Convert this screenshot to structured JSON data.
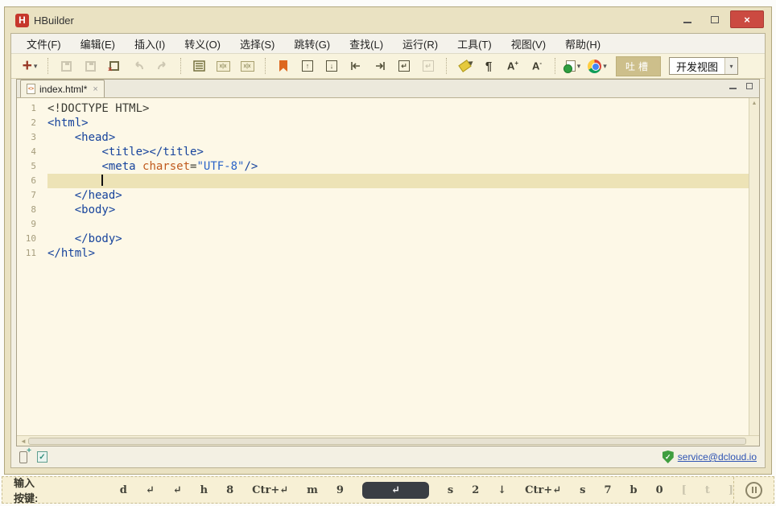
{
  "window": {
    "title": "HBuilder",
    "controls": {
      "minimize": "minimize",
      "maximize": "maximize",
      "close": "×"
    }
  },
  "menu": {
    "items": [
      "文件(F)",
      "编辑(E)",
      "插入(I)",
      "转义(O)",
      "选择(S)",
      "跳转(G)",
      "查找(L)",
      "运行(R)",
      "工具(T)",
      "视图(V)",
      "帮助(H)"
    ]
  },
  "toolbar": {
    "icons": [
      "new-file",
      "save",
      "save-all",
      "close-all",
      "undo",
      "redo",
      "format-code",
      "xml-validate",
      "xml-schema",
      "bookmark",
      "import-line",
      "extract-line",
      "jump-line-start",
      "jump-line-end",
      "soft-wrap",
      "soft-wrap-disabled",
      "highlighter",
      "pilcrow",
      "font-increase",
      "font-decrease",
      "run-in-browser",
      "chrome-browser"
    ],
    "glyphs": {
      "plus": "+",
      "caret": "▾",
      "pilcrow": "¶",
      "font_increase": "A",
      "font_increase_sup": "+",
      "font_decrease": "A",
      "font_decrease_sup": "-",
      "xml": "x|x"
    },
    "feedback_label": "吐槽",
    "view_select_value": "开发视图"
  },
  "tabbar": {
    "tabs": [
      {
        "label": "index.html*",
        "close": "×",
        "icon": "html-file"
      }
    ]
  },
  "editor": {
    "lines": [
      {
        "n": 1,
        "indent": 0,
        "segments": [
          {
            "t": "<!DOCTYPE HTML>",
            "c": "doctype"
          }
        ]
      },
      {
        "n": 2,
        "indent": 0,
        "segments": [
          {
            "t": "<html>",
            "c": "tag"
          }
        ]
      },
      {
        "n": 3,
        "indent": 1,
        "segments": [
          {
            "t": "<head>",
            "c": "tag"
          }
        ]
      },
      {
        "n": 4,
        "indent": 2,
        "segments": [
          {
            "t": "<title></title>",
            "c": "tag"
          }
        ]
      },
      {
        "n": 5,
        "indent": 2,
        "segments": [
          {
            "t": "<meta ",
            "c": "tag"
          },
          {
            "t": "charset",
            "c": "attr"
          },
          {
            "t": "=",
            "c": "plain"
          },
          {
            "t": "\"UTF-8\"",
            "c": "str"
          },
          {
            "t": "/>",
            "c": "tag"
          }
        ]
      },
      {
        "n": 6,
        "indent": 2,
        "segments": [],
        "current": true,
        "cursor": true
      },
      {
        "n": 7,
        "indent": 1,
        "segments": [
          {
            "t": "</head>",
            "c": "tag"
          }
        ]
      },
      {
        "n": 8,
        "indent": 1,
        "segments": [
          {
            "t": "<body>",
            "c": "tag"
          }
        ]
      },
      {
        "n": 9,
        "indent": 0,
        "segments": []
      },
      {
        "n": 10,
        "indent": 1,
        "segments": [
          {
            "t": "</body>",
            "c": "tag"
          }
        ]
      },
      {
        "n": 11,
        "indent": 0,
        "segments": [
          {
            "t": "</html>",
            "c": "tag"
          }
        ]
      }
    ]
  },
  "statusbar": {
    "icons": [
      "device-plus",
      "clipboard-check",
      "shield-check"
    ],
    "link_label": "service@dcloud.io"
  },
  "keybar": {
    "label": "输入按键:",
    "keys": [
      {
        "t": "d"
      },
      {
        "t": "↵"
      },
      {
        "t": "↵"
      },
      {
        "t": "h"
      },
      {
        "t": "8"
      },
      {
        "t": "Ctr+↵"
      },
      {
        "t": "m"
      },
      {
        "t": "9"
      },
      {
        "t": "↵",
        "style": "dark"
      },
      {
        "t": "s"
      },
      {
        "t": "2"
      },
      {
        "t": "↓"
      },
      {
        "t": "Ctr+↵"
      },
      {
        "t": "s"
      },
      {
        "t": "7"
      },
      {
        "t": "b"
      },
      {
        "t": "0"
      },
      {
        "t": "[",
        "style": "faded"
      },
      {
        "t": "t",
        "style": "faded"
      },
      {
        "t": "]",
        "style": "faded"
      }
    ]
  },
  "colors": {
    "frame": "#EAE2C2",
    "toolbar_bg": "#F8F3DD",
    "editor_bg": "#FDF8E7",
    "current_line": "#EDE3B6",
    "tag": "#16439c",
    "attr": "#c05a1d",
    "string": "#2a63c8",
    "close_button": "#cb4a41",
    "bookmark": "#DD671E",
    "link": "#2f54b4",
    "dark_key": "#3a3e44"
  }
}
